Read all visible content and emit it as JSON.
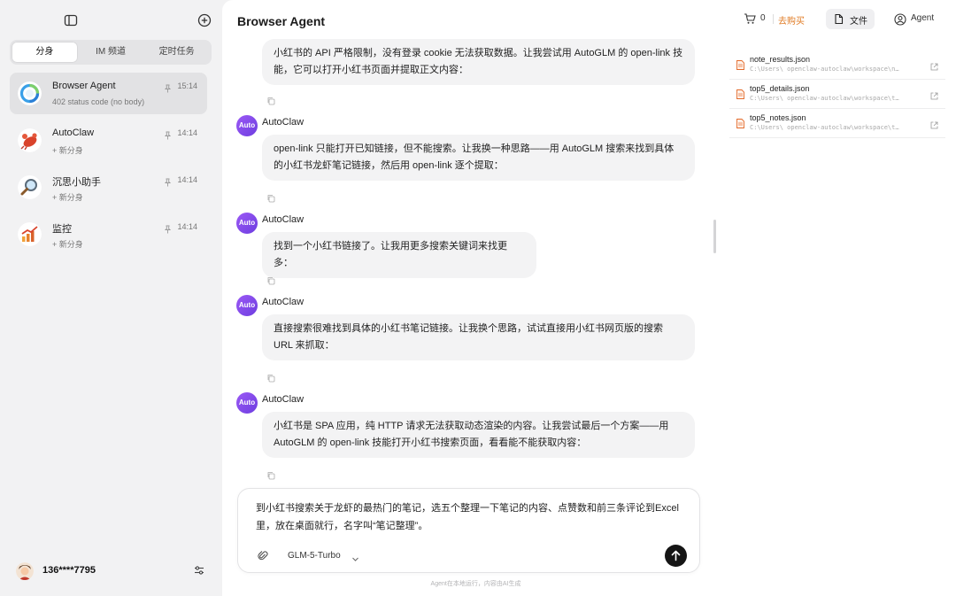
{
  "sidebar": {
    "tabs": [
      {
        "label": "分身"
      },
      {
        "label": "IM 频道"
      },
      {
        "label": "定时任务"
      }
    ],
    "agents": [
      {
        "name": "Browser Agent",
        "sub": "402 status code (no body)",
        "time": "15:14",
        "icon": "browser-agent-logo"
      },
      {
        "name": "AutoClaw",
        "sub": "+ 新分身",
        "time": "14:14",
        "icon": "lobster-icon"
      },
      {
        "name": "沉思小助手",
        "sub": "+ 新分身",
        "time": "14:14",
        "icon": "magnifier-icon"
      },
      {
        "name": "监控",
        "sub": "+ 新分身",
        "time": "14:14",
        "icon": "chart-icon"
      }
    ],
    "user": {
      "name": "136****7795"
    }
  },
  "header": {
    "title": "Browser Agent",
    "cart_count": "0",
    "buy_label": "去购买",
    "files_label": "文件",
    "agent_label": "Agent"
  },
  "files": [
    {
      "name": "note_results.json",
      "path": "C:\\Users\\      openclaw-autoclaw\\workspace\\n…"
    },
    {
      "name": "top5_details.json",
      "path": "C:\\Users\\      openclaw-autoclaw\\workspace\\t…"
    },
    {
      "name": "top5_notes.json",
      "path": "C:\\Users\\      openclaw-autoclaw\\workspace\\t…"
    }
  ],
  "chat": {
    "sender": "AutoClaw",
    "avatar_label": "Auto",
    "messages": [
      {
        "text": "小红书的 API 严格限制，没有登录 cookie 无法获取数据。让我尝试用 AutoGLM 的 open-link 技能，它可以打开小红书页面并提取正文内容："
      },
      {
        "text": "open-link 只能打开已知链接，但不能搜索。让我换一种思路——用 AutoGLM 搜索来找到具体的小红书龙虾笔记链接，然后用 open-link 逐个提取："
      },
      {
        "text": "找到一个小红书链接了。让我用更多搜索关键词来找更多："
      },
      {
        "text": "直接搜索很难找到具体的小红书笔记链接。让我换个思路，试试直接用小红书网页版的搜索 URL 来抓取："
      },
      {
        "text": "小红书是 SPA 应用，纯 HTTP 请求无法获取动态渲染的内容。让我尝试最后一个方案——用 AutoGLM 的 open-link 技能打开小红书搜索页面，看看能不能获取内容："
      }
    ]
  },
  "composer": {
    "text": "到小红书搜索关于龙虾的最热门的笔记，选五个整理一下笔记的内容、点赞数和前三条评论到Excel里，放在桌面就行，名字叫“笔记整理”。",
    "model": "GLM-5-Turbo"
  },
  "footer_note": "Agent在本地运行，内容由AI生成",
  "colors": {
    "accent": "#e07a22",
    "avatar": "#8a4cf0",
    "send": "#151515"
  }
}
